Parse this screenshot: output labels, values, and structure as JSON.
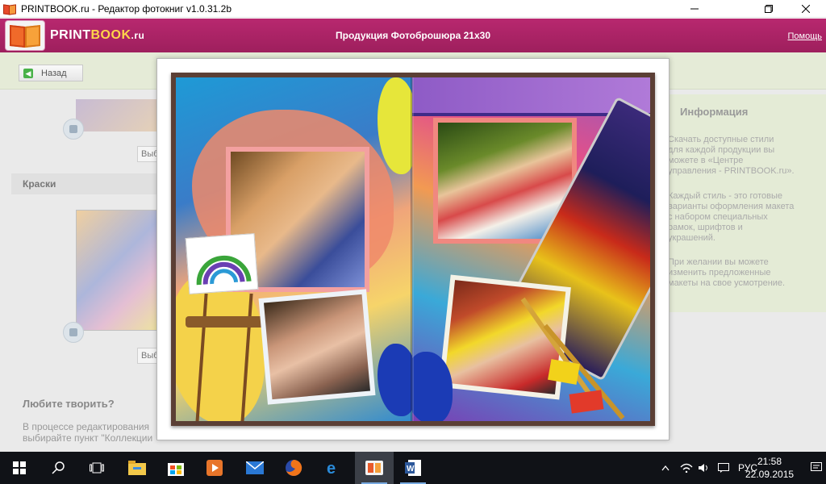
{
  "window": {
    "title": "PRINTBOOK.ru - Редактор фотокниг v1.0.31.2b",
    "minimize_icon": "minimize-icon",
    "maximize_icon": "maximize-icon",
    "close_icon": "close-icon"
  },
  "header": {
    "logo_main": "PRINT",
    "logo_accent": "BOOK",
    "logo_tld": ".ru",
    "title": "Продукция Фотоброшюра 21х30",
    "help_link": "Помощь",
    "brand_color": "#a8236a"
  },
  "toolbar": {
    "back_label": "Назад"
  },
  "left_panel": {
    "select_label_1": "Выб",
    "section_title": "Краски",
    "select_label_2": "Выб",
    "hint_title": "Любите творить?",
    "hint_line_1": "В процессе редактирования",
    "hint_line_2": "выбирайте пункт \"Коллекции"
  },
  "info_panel": {
    "title": "Информация",
    "paragraph_1": [
      "Скачать доступные стили",
      "для каждой продукции вы",
      "можете в «Центре",
      "управления - PRINTBOOK.ru»."
    ],
    "paragraph_2": [
      "Каждый стиль - это готовые",
      "варианты оформления макета",
      "с набором специальных",
      "рамок, шрифтов и",
      "украшений."
    ],
    "paragraph_3": [
      "При желании вы можете",
      "изменить предложенные",
      "макеты на свое усмотрение."
    ]
  },
  "taskbar": {
    "icons": [
      "windows-start-icon",
      "search-icon",
      "task-view-icon",
      "file-explorer-icon",
      "store-icon",
      "media-player-icon",
      "mail-icon",
      "firefox-icon",
      "edge-icon",
      "printbook-app-icon",
      "word-icon"
    ],
    "language": "РУС",
    "time": "21:58",
    "date": "22.09.2015"
  }
}
